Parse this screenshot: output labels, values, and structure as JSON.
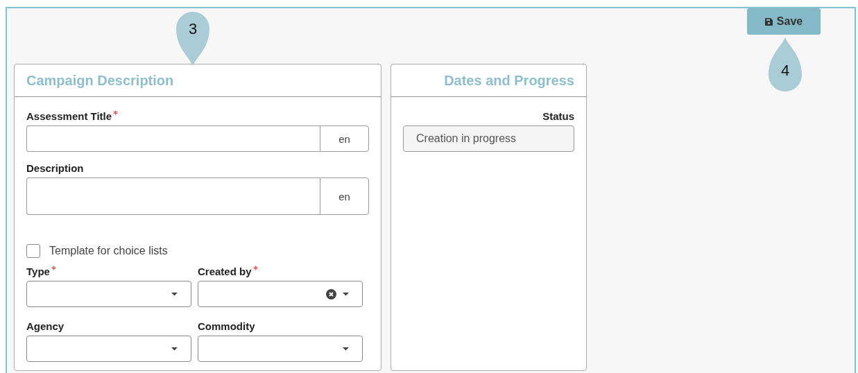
{
  "save_button": {
    "label": "Save"
  },
  "callouts": [
    {
      "label": "3",
      "kind": "down"
    },
    {
      "label": "4",
      "kind": "up"
    }
  ],
  "campaign_description": {
    "title": "Campaign Description",
    "fields": [
      {
        "kind": "text",
        "label": "Assessment Title",
        "required": true,
        "addon": "en"
      },
      {
        "kind": "textarea",
        "label": "Description",
        "required": false,
        "addon": "en"
      }
    ],
    "checkbox": {
      "label": "Template for choice lists",
      "checked": false
    },
    "selects": [
      {
        "label": "Type",
        "required": true,
        "clearable": false
      },
      {
        "label": "Created by",
        "required": true,
        "clearable": true
      },
      {
        "label": "Agency",
        "required": false,
        "clearable": false
      },
      {
        "label": "Commodity",
        "required": false,
        "clearable": false
      }
    ]
  },
  "dates_and_progress": {
    "title": "Dates and Progress",
    "status": {
      "label": "Status",
      "value": "Creation in progress"
    }
  }
}
